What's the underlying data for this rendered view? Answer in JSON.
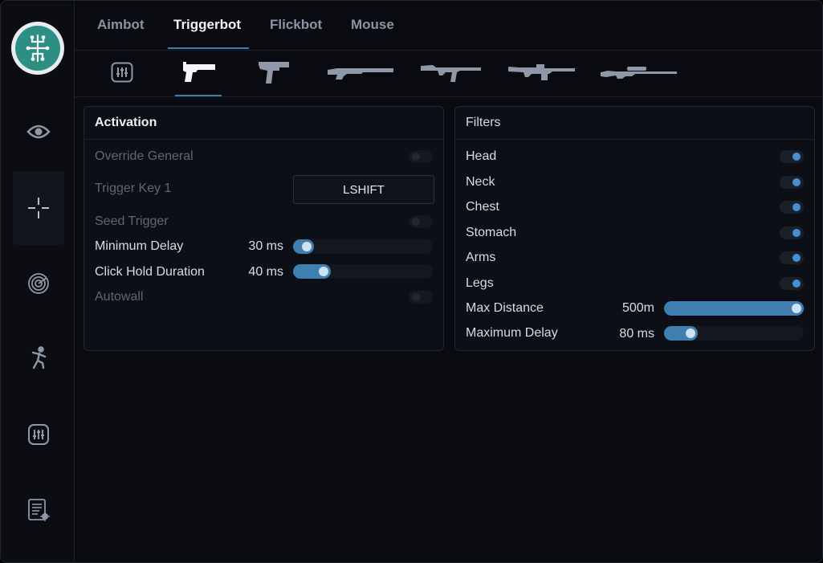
{
  "tabs": [
    "Aimbot",
    "Triggerbot",
    "Flickbot",
    "Mouse"
  ],
  "active_tab": "Triggerbot",
  "weapon_tabs": [
    "settings-icon",
    "pistol-icon",
    "smg-icon",
    "shotgun-icon",
    "rifle-icon",
    "lmg-icon",
    "sniper-icon"
  ],
  "active_weapon_tab": "pistol-icon",
  "sidebar": [
    "eye-icon",
    "crosshair-icon",
    "radar-icon",
    "figure-icon",
    "settings-icon",
    "log-icon"
  ],
  "activation": {
    "title": "Activation",
    "override_general": "Override General",
    "trigger_key_label": "Trigger Key 1",
    "trigger_key_value": "LSHIFT",
    "seed_trigger": "Seed Trigger",
    "min_delay_label": "Minimum Delay",
    "min_delay_value": "30 ms",
    "min_delay_fraction": 0.15,
    "click_hold_label": "Click Hold Duration",
    "click_hold_value": "40 ms",
    "click_hold_fraction": 0.27,
    "autowall": "Autowall"
  },
  "filters": {
    "title": "Filters",
    "head": "Head",
    "neck": "Neck",
    "chest": "Chest",
    "stomach": "Stomach",
    "arms": "Arms",
    "legs": "Legs",
    "max_distance_label": "Max Distance",
    "max_distance_value": "500m",
    "max_distance_fraction": 1.0,
    "max_delay_label": "Maximum Delay",
    "max_delay_value": "80 ms",
    "max_delay_fraction": 0.24
  },
  "colors": {
    "accent": "#3f7fb0",
    "background": "#090b10",
    "panel": "#0c0f15"
  }
}
